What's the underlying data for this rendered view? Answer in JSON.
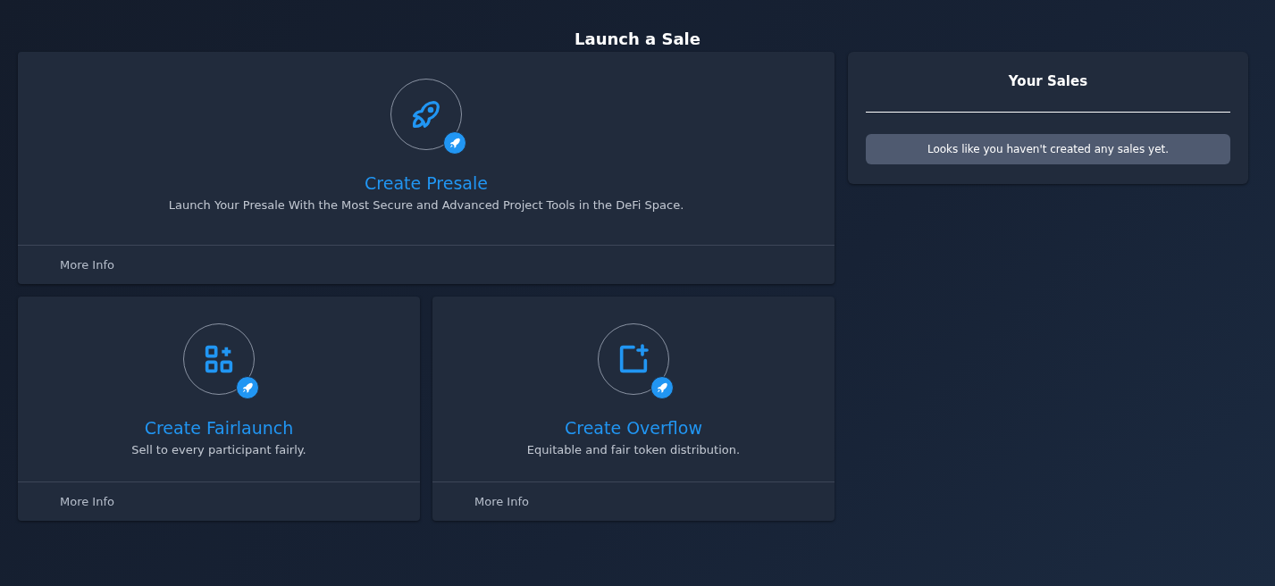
{
  "page_title": "Launch a Sale",
  "cards": [
    {
      "kind": "rocket",
      "title": "Create Presale",
      "description": "Launch Your Presale With the Most Secure and Advanced Project Tools in the DeFi Space.",
      "link": "More Info"
    },
    {
      "kind": "grid",
      "title": "Create Fairlaunch",
      "description": "Sell to every participant fairly.",
      "link": "More Info"
    },
    {
      "kind": "square-plus",
      "title": "Create Overflow",
      "description": "Equitable and fair token distribution.",
      "link": "More Info"
    }
  ],
  "your_sales": {
    "title": "Your Sales",
    "empty_message": "Looks like you haven't created any sales yet."
  }
}
